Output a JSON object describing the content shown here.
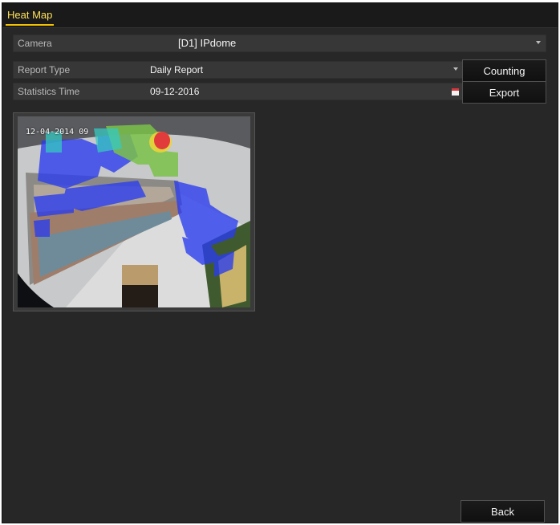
{
  "tab": {
    "label": "Heat Map"
  },
  "camera": {
    "label": "Camera",
    "value": "[D1] IPdome"
  },
  "report_type": {
    "label": "Report Type",
    "value": "Daily Report"
  },
  "statistics_time": {
    "label": "Statistics Time",
    "value": "09-12-2016"
  },
  "buttons": {
    "counting": "Counting",
    "export": "Export",
    "back": "Back"
  },
  "preview": {
    "timestamp": "12-04-2014 09"
  },
  "icons": {
    "dropdown": "chevron-down-icon",
    "calendar": "calendar-icon"
  },
  "colors": {
    "tab_accent": "#f2c200",
    "heat_high": "#e23b3b",
    "heat_mid": "#7bc24a",
    "heat_low": "#2a3cf0"
  }
}
